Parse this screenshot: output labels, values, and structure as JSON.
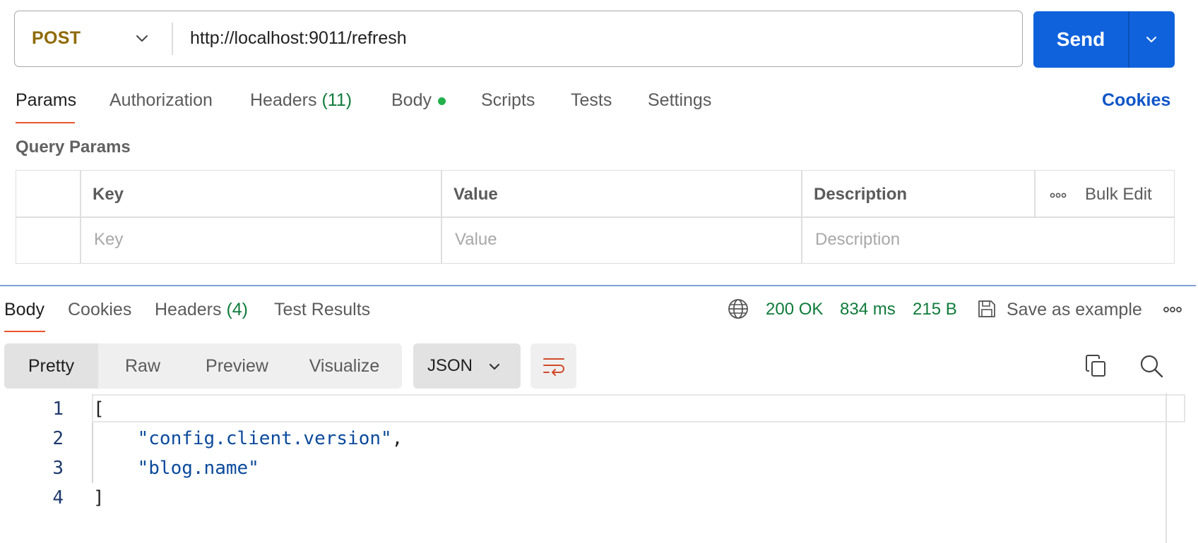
{
  "request": {
    "method": "POST",
    "url": "http://localhost:9011/refresh",
    "send_label": "Send"
  },
  "request_tabs": {
    "params": "Params",
    "authorization": "Authorization",
    "headers": "Headers",
    "headers_count": "(11)",
    "body": "Body",
    "scripts": "Scripts",
    "tests": "Tests",
    "settings": "Settings",
    "cookies": "Cookies"
  },
  "query_params": {
    "title": "Query Params",
    "columns": {
      "key": "Key",
      "value": "Value",
      "description": "Description"
    },
    "bulk_edit": "Bulk Edit",
    "placeholders": {
      "key": "Key",
      "value": "Value",
      "description": "Description"
    }
  },
  "response_tabs": {
    "body": "Body",
    "cookies": "Cookies",
    "headers": "Headers",
    "headers_count": "(4)",
    "test_results": "Test Results"
  },
  "response_meta": {
    "status": "200 OK",
    "time": "834 ms",
    "size": "215 B",
    "save_example": "Save as example"
  },
  "view_modes": {
    "pretty": "Pretty",
    "raw": "Raw",
    "preview": "Preview",
    "visualize": "Visualize",
    "format": "JSON"
  },
  "code_lines": [
    {
      "num": "1",
      "text": "["
    },
    {
      "num": "2",
      "text": "\"config.client.version\"",
      "suffix": ","
    },
    {
      "num": "3",
      "text": "\"blog.name\""
    },
    {
      "num": "4",
      "text": "]"
    }
  ],
  "icons": {
    "method_chevron": "chevron-down-icon",
    "send_chevron": "chevron-down-icon",
    "more": "more-horizontal-icon",
    "globe": "globe-icon",
    "save": "save-icon",
    "wrap": "wrap-lines-icon",
    "copy": "copy-icon",
    "search": "search-icon"
  },
  "colors": {
    "accent_blue": "#0f62dc",
    "method_post": "#8f6a00",
    "status_green": "#0f7b3a",
    "active_tab_underline": "#e8552e"
  }
}
